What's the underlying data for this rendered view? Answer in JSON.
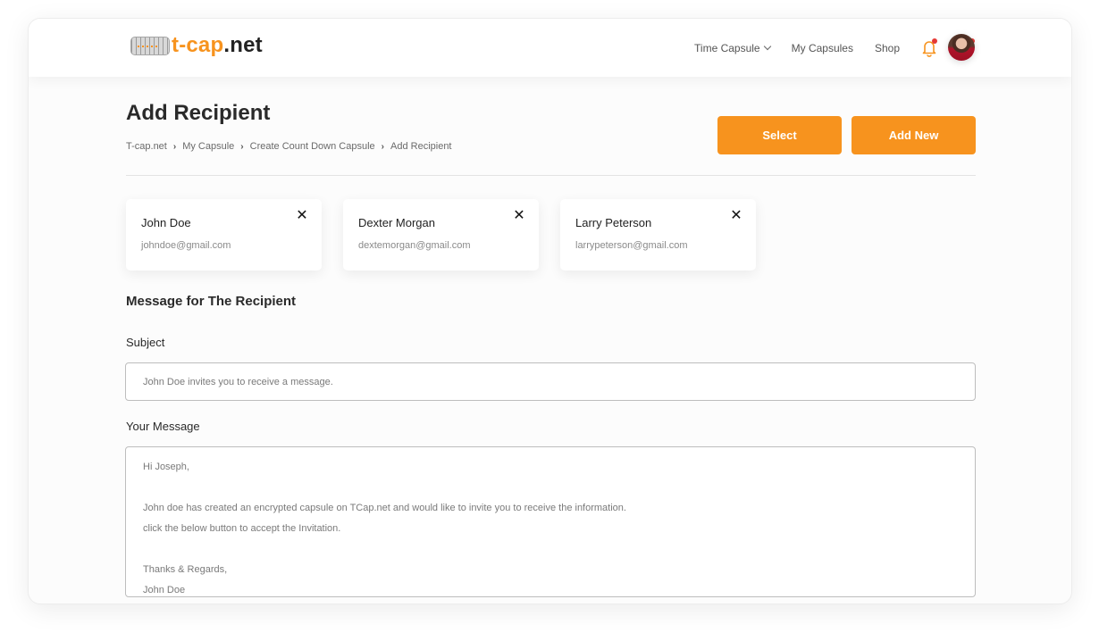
{
  "header": {
    "logo": {
      "icon": "time-capsule-cylinder-icon",
      "text_accent": "t-cap",
      "text_rest": ".net"
    },
    "nav": [
      {
        "label": "Time Capsule",
        "has_dropdown": true
      },
      {
        "label": "My Capsules",
        "has_dropdown": false
      },
      {
        "label": "Shop",
        "has_dropdown": false
      }
    ],
    "icons": [
      {
        "name": "bell-icon",
        "has_badge": true
      },
      {
        "name": "capsule-grid-icon",
        "has_badge": true
      }
    ],
    "avatar": "user-avatar"
  },
  "page": {
    "title": "Add Recipient",
    "breadcrumb": [
      "T-cap.net",
      "My Capsule",
      "Create Count Down Capsule",
      "Add Recipient"
    ],
    "buttons": {
      "select": "Select",
      "add_new": "Add New"
    }
  },
  "recipients": [
    {
      "name": "John Doe",
      "email": "johndoe@gmail.com"
    },
    {
      "name": "Dexter Morgan",
      "email": "dextemorgan@gmail.com"
    },
    {
      "name": "Larry Peterson",
      "email": "larrypeterson@gmail.com"
    }
  ],
  "message_form": {
    "section_title": "Message for The Recipient",
    "subject_label": "Subject",
    "subject_value": "John Doe invites you to receive a message.",
    "message_label": "Your Message",
    "message_lines": [
      "Hi Joseph,",
      "",
      "John doe has created an encrypted capsule on TCap.net and would like to invite you to receive the information.",
      "click the below button to accept the Invitation.",
      "",
      "Thanks & Regards,",
      "John Doe"
    ]
  },
  "colors": {
    "accent": "#f7931e",
    "badge": "#e53935"
  }
}
